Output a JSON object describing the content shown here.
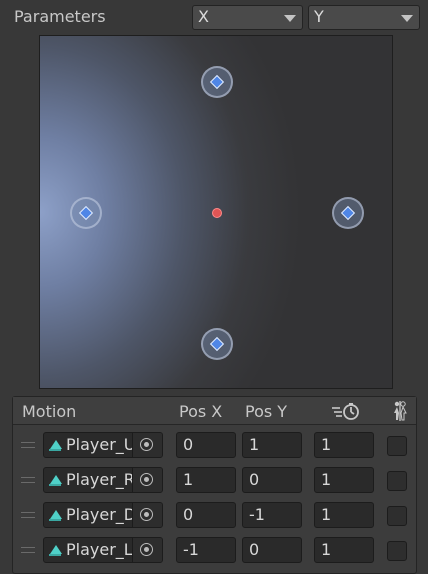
{
  "parameters": {
    "label": "Parameters",
    "param_x": "X",
    "param_y": "Y"
  },
  "graph": {
    "nodes": [
      {
        "name": "node-top",
        "pos_x": 0,
        "pos_y": 1
      },
      {
        "name": "node-right",
        "pos_x": 1,
        "pos_y": 0
      },
      {
        "name": "node-bottom",
        "pos_x": 0,
        "pos_y": -1
      },
      {
        "name": "node-left",
        "pos_x": -1,
        "pos_y": 0
      }
    ],
    "current": {
      "x": 0,
      "y": 0
    }
  },
  "motion_list": {
    "headers": {
      "motion": "Motion",
      "pos_x": "Pos X",
      "pos_y": "Pos Y",
      "speed_icon": "speed-icon",
      "mirror_icon": "mirror-icon"
    },
    "rows": [
      {
        "clip": "Player_Up",
        "pos_x": "0",
        "pos_y": "1",
        "speed": "1",
        "mirror": false
      },
      {
        "clip": "Player_Right",
        "pos_x": "1",
        "pos_y": "0",
        "speed": "1",
        "mirror": false
      },
      {
        "clip": "Player_Down",
        "pos_x": "0",
        "pos_y": "-1",
        "speed": "1",
        "mirror": false
      },
      {
        "clip": "Player_Left",
        "pos_x": "-1",
        "pos_y": "0",
        "speed": "1",
        "mirror": false
      }
    ]
  },
  "colors": {
    "node_diamond": "#4f86e6",
    "current_dot": "#e05555",
    "clip_icon": "#4fd0c8"
  }
}
